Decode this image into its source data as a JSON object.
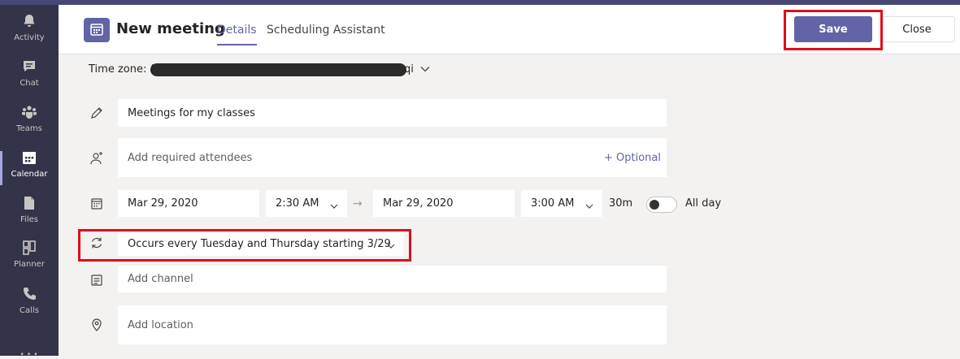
{
  "rail": {
    "items": [
      {
        "label": "Activity",
        "icon": "bell-icon"
      },
      {
        "label": "Chat",
        "icon": "chat-icon"
      },
      {
        "label": "Teams",
        "icon": "teams-icon"
      },
      {
        "label": "Calendar",
        "icon": "calendar-icon",
        "active": true
      },
      {
        "label": "Files",
        "icon": "file-icon"
      },
      {
        "label": "Planner",
        "icon": "planner-icon"
      },
      {
        "label": "Calls",
        "icon": "phone-icon"
      }
    ],
    "more": "..."
  },
  "header": {
    "title": "New meeting",
    "tabs": [
      {
        "label": "Details",
        "active": true
      },
      {
        "label": "Scheduling Assistant"
      }
    ],
    "save_label": "Save",
    "close_label": "Close"
  },
  "timezone": {
    "label": "Time zone: (",
    "suffix": "qi"
  },
  "form": {
    "title_value": "Meetings for my classes",
    "attendees_placeholder": "Add required attendees",
    "optional_label": "+ Optional",
    "start_date": "Mar 29, 2020",
    "start_time": "2:30 AM",
    "end_date": "Mar 29, 2020",
    "end_time": "3:00 AM",
    "duration": "30m",
    "all_day_label": "All day",
    "all_day_on": false,
    "recurrence": "Occurs every Tuesday and Thursday starting 3/29",
    "channel_placeholder": "Add channel",
    "location_placeholder": "Add location"
  },
  "colors": {
    "accent": "#6264a7",
    "rail": "#33344a",
    "highlight": "#e00b1c"
  }
}
